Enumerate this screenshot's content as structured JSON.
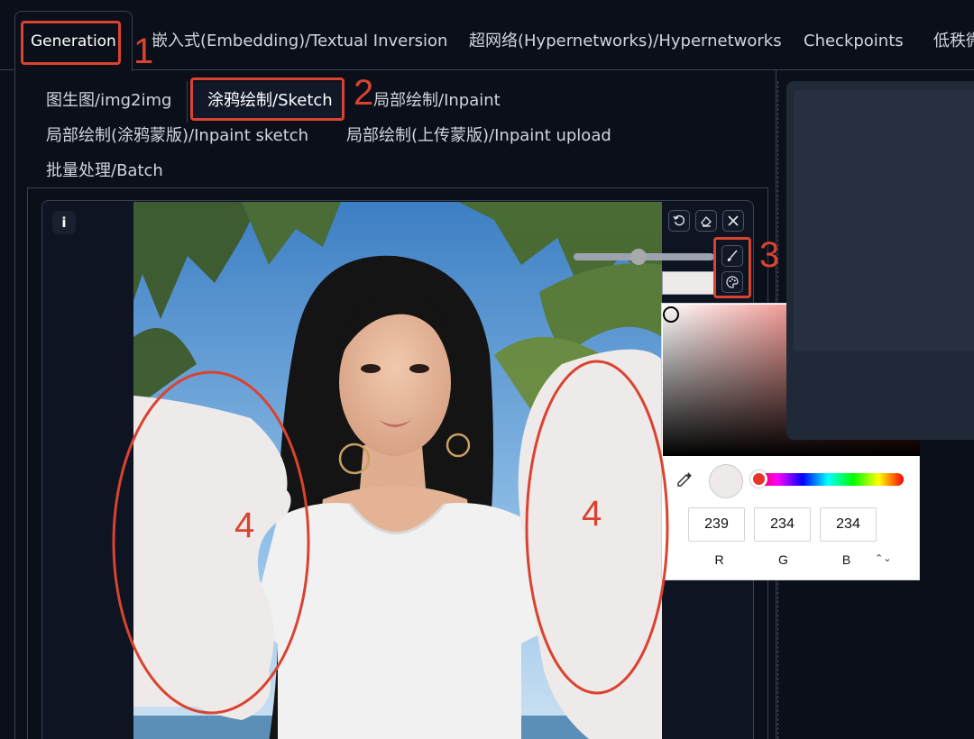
{
  "top_tabs": [
    {
      "label": "Generation"
    },
    {
      "label": "嵌入式(Embedding)/Textual Inversion"
    },
    {
      "label": "超网络(Hypernetworks)/Hypernetworks"
    },
    {
      "label": "Checkpoints"
    },
    {
      "label": "低秩微"
    }
  ],
  "sub_tabs": [
    {
      "label": "图生图/img2img"
    },
    {
      "label": "涂鸦绘制/Sketch"
    },
    {
      "label": "局部绘制/Inpaint"
    },
    {
      "label": "局部绘制(涂鸦蒙版)/Inpaint sketch"
    },
    {
      "label": "局部绘制(上传蒙版)/Inpaint upload"
    },
    {
      "label": "批量处理/Batch"
    }
  ],
  "canvas": {
    "info_label": "i",
    "brush_size_fraction": 0.46,
    "toolbar_icons": [
      "undo-icon",
      "eraser-icon",
      "close-icon",
      "brush-icon",
      "palette-icon"
    ]
  },
  "color_picker": {
    "selected_color": "#efeaea",
    "hue_color": "#e8352a",
    "r": "239",
    "g": "234",
    "b": "234",
    "r_label": "R",
    "g_label": "G",
    "b_label": "B",
    "mode_toggle": "⌃⌄",
    "eyedropper_icon": "eyedropper-icon"
  },
  "annotations": {
    "n1": "1",
    "n2": "2",
    "n3": "3",
    "n4_left": "4",
    "n4_right": "4",
    "color": "#d9432f"
  }
}
